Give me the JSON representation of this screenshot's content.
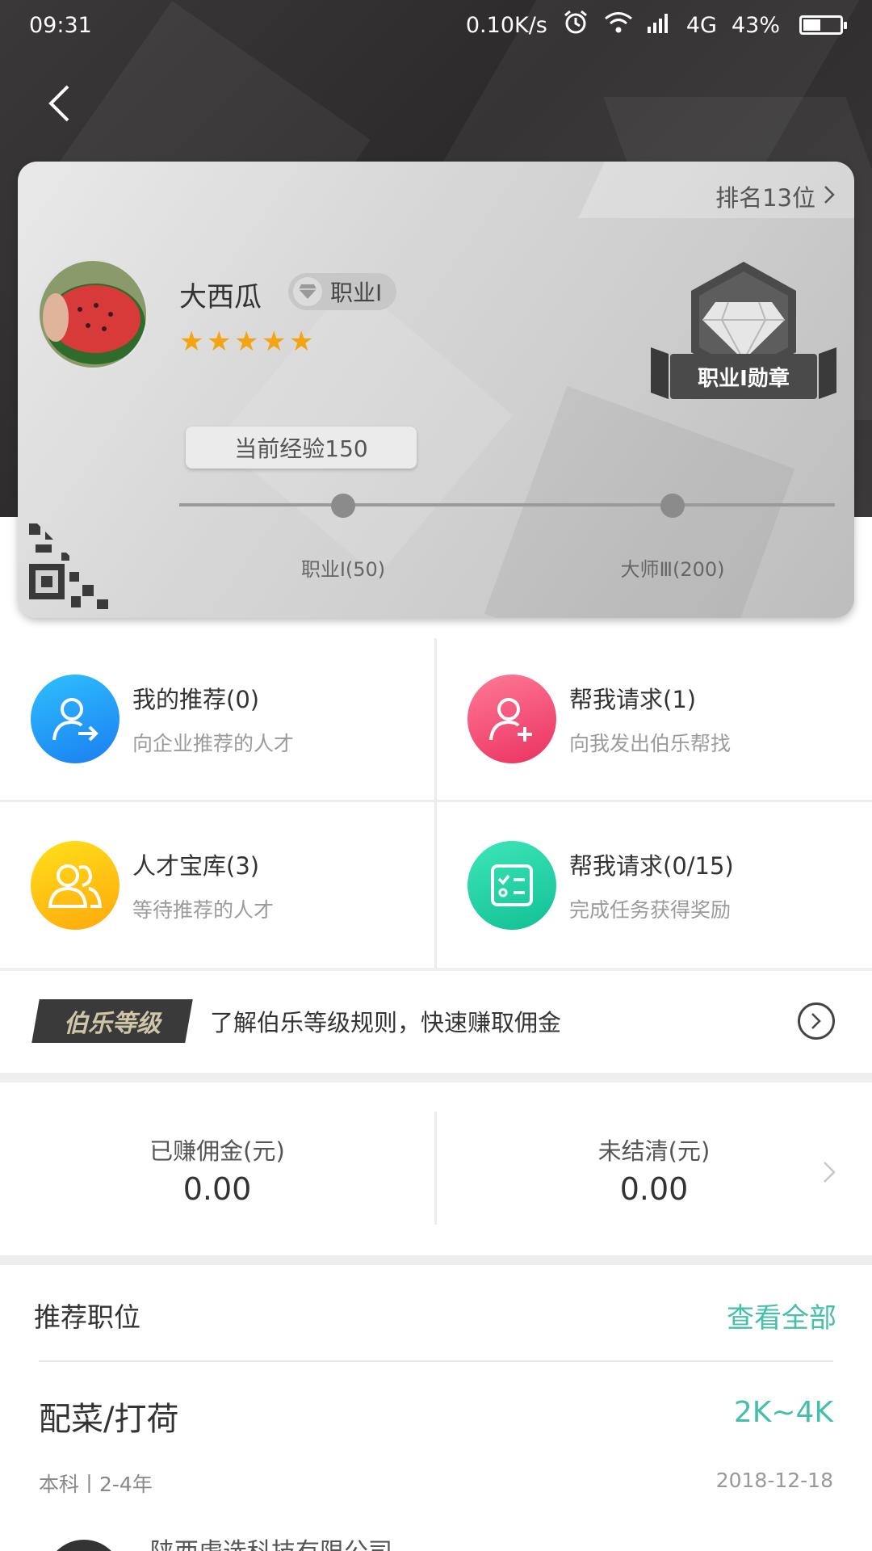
{
  "status_bar": {
    "time": "09:31",
    "net_speed": "0.10K/s",
    "network": "4G",
    "battery_pct": "43%",
    "battery_level": 0.43
  },
  "card": {
    "rank": "排名13位",
    "user_name": "大西瓜",
    "level_chip": "职业Ⅰ",
    "stars": 5,
    "badge_label": "职业Ⅰ勋章",
    "current_exp": "当前经验150",
    "milestones": [
      {
        "label": "职业Ⅰ(50)"
      },
      {
        "label": "大师Ⅲ(200)"
      }
    ]
  },
  "grid": [
    {
      "title": "我的推荐(0)",
      "sub": "向企业推荐的人才",
      "icon": "user-arrow-icon",
      "color_from": "#2fb8ff",
      "color_to": "#1b86f2"
    },
    {
      "title": "帮我请求(1)",
      "sub": "向我发出伯乐帮找",
      "icon": "user-plus-icon",
      "color_from": "#ff6f8f",
      "color_to": "#ee3865"
    },
    {
      "title": "人才宝库(3)",
      "sub": "等待推荐的人才",
      "icon": "users-icon",
      "color_from": "#ffd21a",
      "color_to": "#ffaf0d"
    },
    {
      "title": "帮我请求(0/15)",
      "sub": "完成任务获得奖励",
      "icon": "checklist-icon",
      "color_from": "#3ae0b5",
      "color_to": "#15c49a"
    }
  ],
  "level_banner": {
    "tag": "伯乐等级",
    "text": "了解伯乐等级规则，快速赚取佣金"
  },
  "money": {
    "earned_label": "已赚佣金(元)",
    "earned_value": "0.00",
    "pending_label": "未结清(元)",
    "pending_value": "0.00"
  },
  "recommend": {
    "title": "推荐职位",
    "view_all": "查看全部"
  },
  "job": {
    "title": "配菜/打荷",
    "salary": "2K~4K",
    "meta": "本科丨2-4年",
    "date": "2018-12-18",
    "company": "陕西虐选科技有限公司"
  },
  "colors": {
    "accent": "#44bfa9",
    "star": "#f4a412"
  }
}
